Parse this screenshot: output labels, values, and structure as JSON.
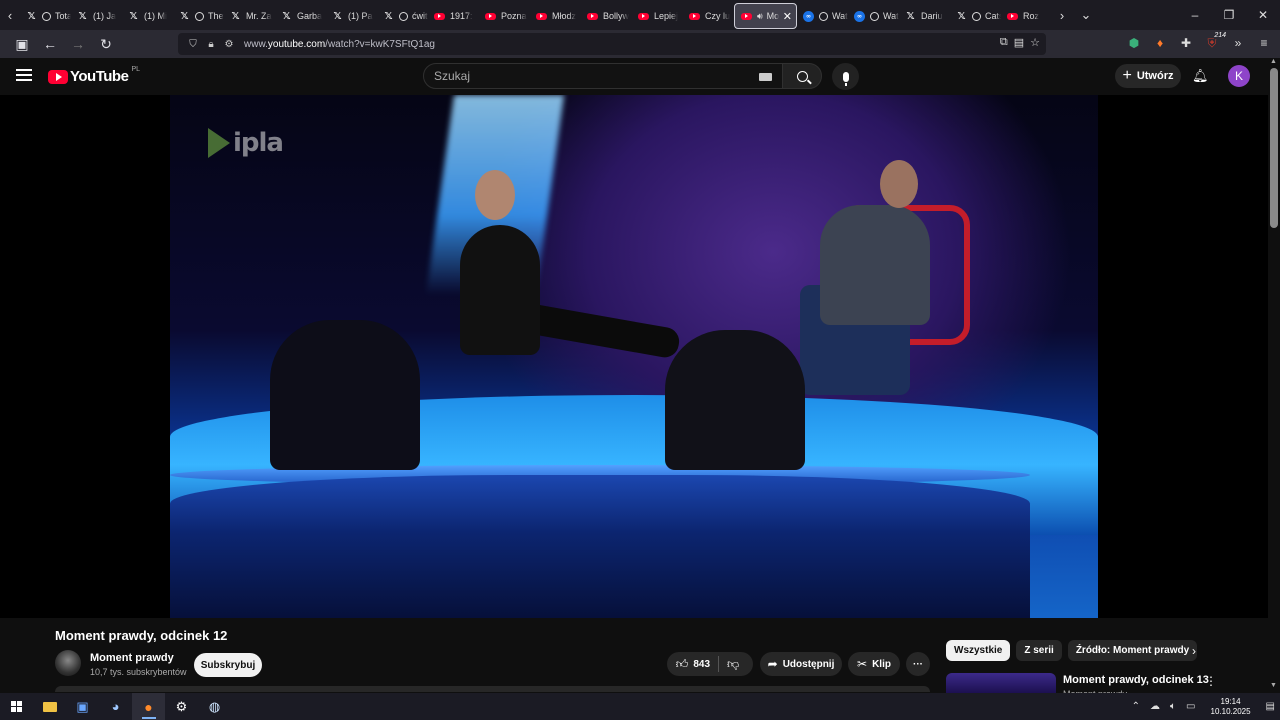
{
  "browser": {
    "tabs": [
      {
        "label": "Totaln",
        "icon": "x-icon"
      },
      {
        "label": "(1) Ja",
        "icon": "x-icon"
      },
      {
        "label": "(1) Mi",
        "icon": "x-icon"
      },
      {
        "label": "They c",
        "icon": "x-icon"
      },
      {
        "label": "Mr. Za",
        "icon": "x-icon"
      },
      {
        "label": "Garba",
        "icon": "x-icon"
      },
      {
        "label": "(1) Pa",
        "icon": "x-icon"
      },
      {
        "label": "ćwitte",
        "icon": "x-icon"
      },
      {
        "label": "1917:",
        "icon": "youtube-icon"
      },
      {
        "label": "Pozna",
        "icon": "youtube-icon"
      },
      {
        "label": "Młodz",
        "icon": "youtube-icon"
      },
      {
        "label": "Bollyw",
        "icon": "youtube-icon"
      },
      {
        "label": "Lepiej",
        "icon": "youtube-icon"
      },
      {
        "label": "Czy lu",
        "icon": "youtube-icon"
      },
      {
        "label": "Mo",
        "icon": "youtube-icon",
        "active": true
      },
      {
        "label": "Watch",
        "icon": "watch-icon"
      },
      {
        "label": "Watch",
        "icon": "watch-icon"
      },
      {
        "label": "Dariu",
        "icon": "x-icon"
      },
      {
        "label": "Cats w",
        "icon": "x-icon"
      },
      {
        "label": "Roz",
        "icon": "youtube-icon"
      }
    ],
    "url_prefix": "www.",
    "url_host": "youtube.com",
    "url_path": "/watch?v=kwK7SFtQ1ag",
    "extension_badge": "214"
  },
  "youtube": {
    "logo_text": "YouTube",
    "country_code": "PL",
    "search_placeholder": "Szukaj",
    "create_label": "Utwórz",
    "avatar_letter": "K"
  },
  "video": {
    "watermark": "ipla",
    "title": "Moment prawdy, odcinek 12",
    "channel_name": "Moment prawdy",
    "subscribers": "10,7 tys. subskrybentów",
    "subscribe_label": "Subskrybuj",
    "like_count": "843",
    "share_label": "Udostępnij",
    "clip_label": "Klip"
  },
  "sidebar": {
    "chips": [
      "Wszystkie",
      "Z serii",
      "Źródło: Moment prawdy"
    ],
    "recommendation_title": "Moment prawdy, odcinek 13",
    "recommendation_channel": "Moment prawdy"
  },
  "taskbar": {
    "time": "19:14",
    "date": "10.10.2025"
  },
  "colors": {
    "accent_red": "#ff0033",
    "avatar_purple": "#8e44c9",
    "background": "#0f0f0f"
  }
}
